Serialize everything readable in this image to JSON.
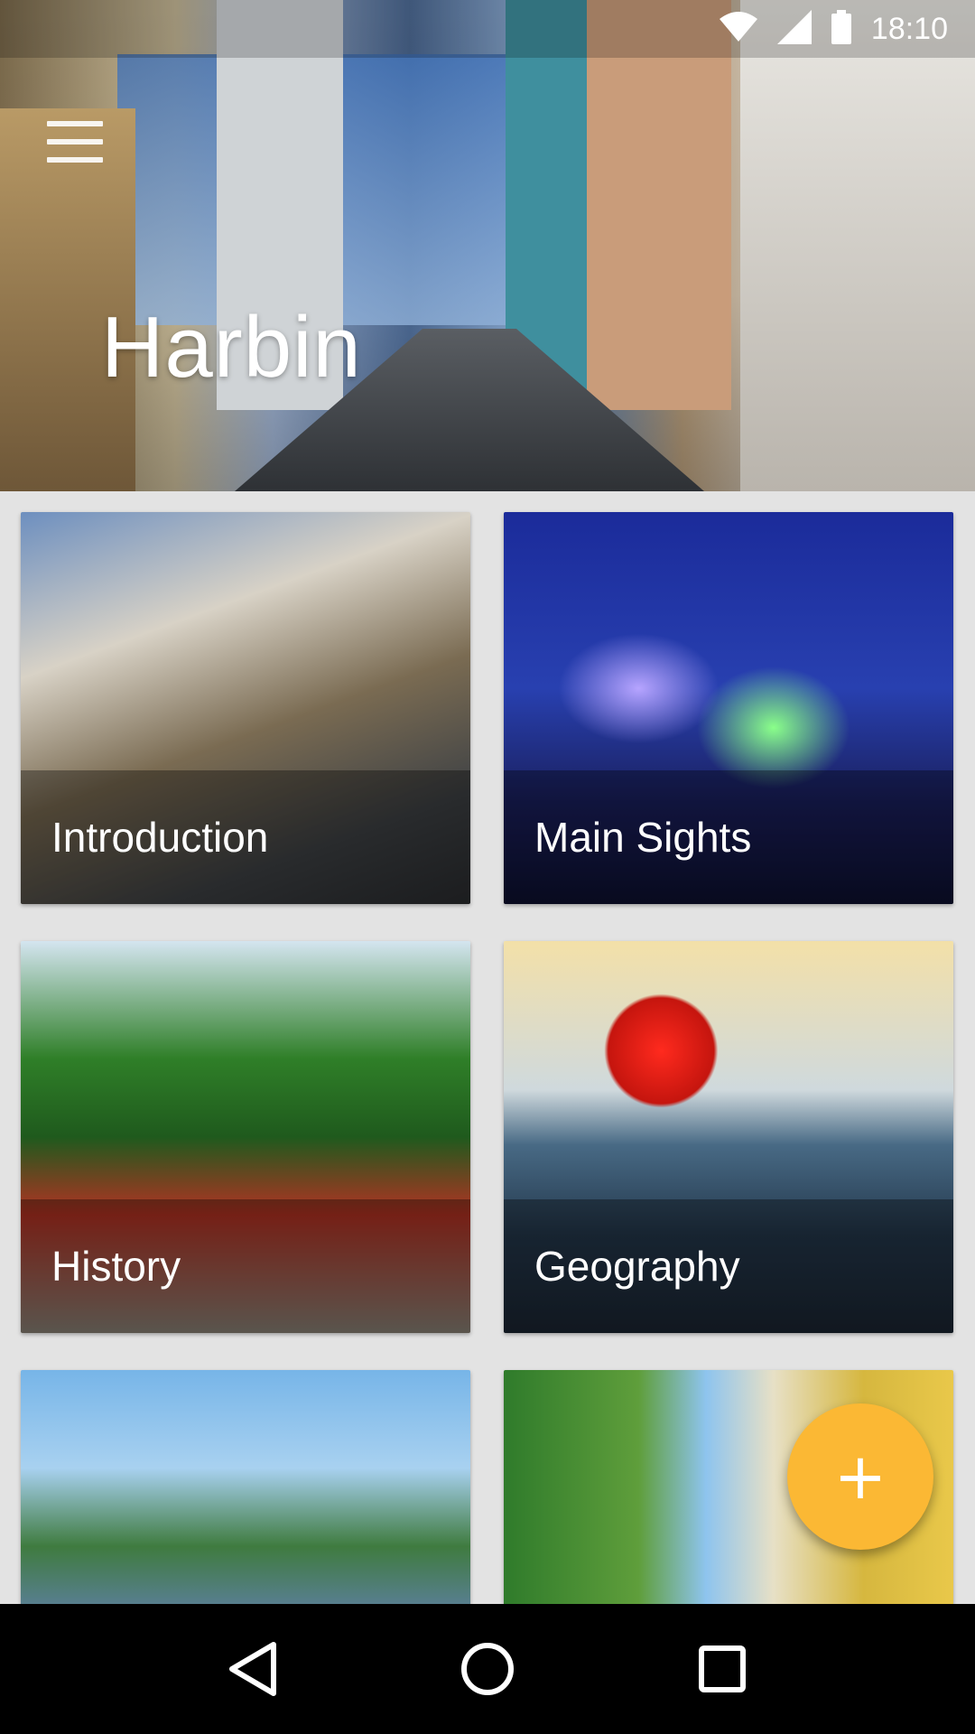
{
  "status_bar": {
    "time": "18:10",
    "icons": [
      "wifi-icon",
      "cellular-signal-icon",
      "battery-icon"
    ]
  },
  "header": {
    "title": "Harbin",
    "menu_icon": "hamburger-menu-icon"
  },
  "cards": [
    {
      "label": "Introduction"
    },
    {
      "label": "Main Sights"
    },
    {
      "label": "History"
    },
    {
      "label": "Geography"
    },
    {
      "label": ""
    },
    {
      "label": ""
    }
  ],
  "fab": {
    "icon": "plus-icon",
    "symbol": "+",
    "color": "#fbb834"
  },
  "navigation_bar": {
    "buttons": [
      "back-icon",
      "home-icon",
      "recents-icon"
    ]
  },
  "colors": {
    "accent": "#fbb834",
    "nav_background": "#000000",
    "page_background": "#e3e3e3"
  }
}
